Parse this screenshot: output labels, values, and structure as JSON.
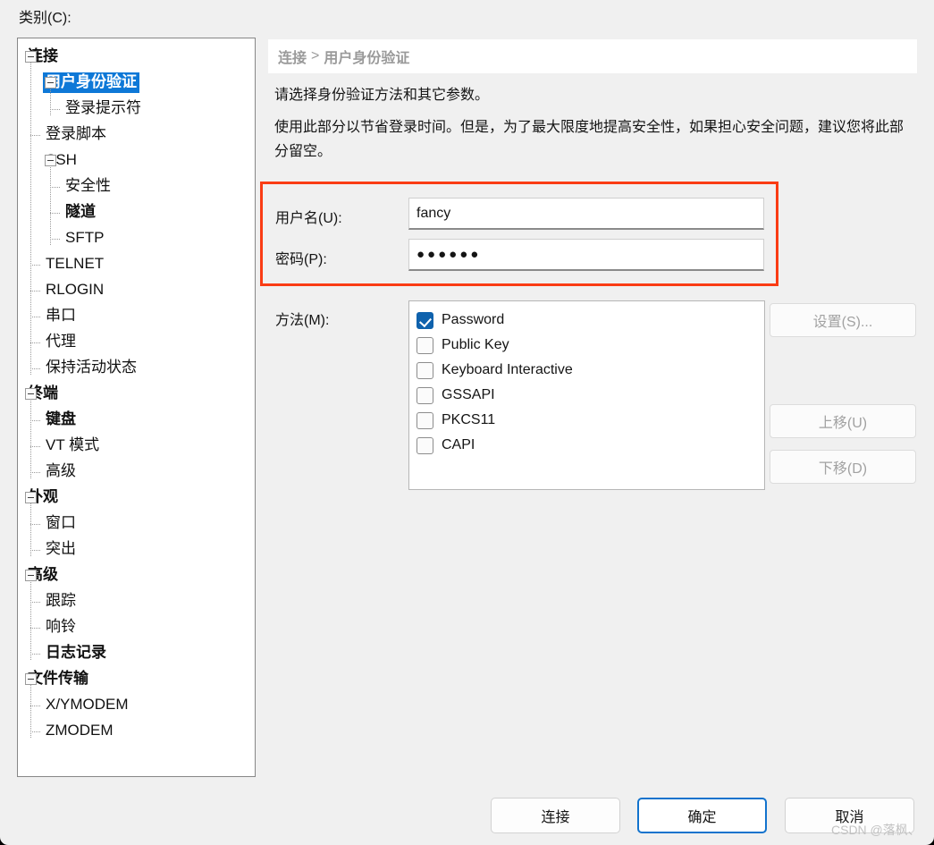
{
  "dialog": {
    "category_label": "类别(C):",
    "watermark": "CSDN @落枫、"
  },
  "tree": {
    "items": [
      {
        "label": "连接",
        "depth": 0,
        "bold": true,
        "selected": false,
        "expander": true
      },
      {
        "label": "用户身份验证",
        "depth": 1,
        "bold": true,
        "selected": true,
        "expander": true
      },
      {
        "label": "登录提示符",
        "depth": 2,
        "bold": false,
        "selected": false,
        "expander": false
      },
      {
        "label": "登录脚本",
        "depth": 1,
        "bold": false,
        "selected": false,
        "expander": false
      },
      {
        "label": "SSH",
        "depth": 1,
        "bold": false,
        "selected": false,
        "expander": true
      },
      {
        "label": "安全性",
        "depth": 2,
        "bold": false,
        "selected": false,
        "expander": false
      },
      {
        "label": "隧道",
        "depth": 2,
        "bold": true,
        "selected": false,
        "expander": false
      },
      {
        "label": "SFTP",
        "depth": 2,
        "bold": false,
        "selected": false,
        "expander": false
      },
      {
        "label": "TELNET",
        "depth": 1,
        "bold": false,
        "selected": false,
        "expander": false
      },
      {
        "label": "RLOGIN",
        "depth": 1,
        "bold": false,
        "selected": false,
        "expander": false
      },
      {
        "label": "串口",
        "depth": 1,
        "bold": false,
        "selected": false,
        "expander": false
      },
      {
        "label": "代理",
        "depth": 1,
        "bold": false,
        "selected": false,
        "expander": false
      },
      {
        "label": "保持活动状态",
        "depth": 1,
        "bold": false,
        "selected": false,
        "expander": false
      },
      {
        "label": "终端",
        "depth": 0,
        "bold": true,
        "selected": false,
        "expander": true
      },
      {
        "label": "键盘",
        "depth": 1,
        "bold": true,
        "selected": false,
        "expander": false
      },
      {
        "label": "VT 模式",
        "depth": 1,
        "bold": false,
        "selected": false,
        "expander": false
      },
      {
        "label": "高级",
        "depth": 1,
        "bold": false,
        "selected": false,
        "expander": false
      },
      {
        "label": "外观",
        "depth": 0,
        "bold": true,
        "selected": false,
        "expander": true
      },
      {
        "label": "窗口",
        "depth": 1,
        "bold": false,
        "selected": false,
        "expander": false
      },
      {
        "label": "突出",
        "depth": 1,
        "bold": false,
        "selected": false,
        "expander": false
      },
      {
        "label": "高级",
        "depth": 0,
        "bold": true,
        "selected": false,
        "expander": true
      },
      {
        "label": "跟踪",
        "depth": 1,
        "bold": false,
        "selected": false,
        "expander": false
      },
      {
        "label": "响铃",
        "depth": 1,
        "bold": false,
        "selected": false,
        "expander": false
      },
      {
        "label": "日志记录",
        "depth": 1,
        "bold": true,
        "selected": false,
        "expander": false
      },
      {
        "label": "文件传输",
        "depth": 0,
        "bold": true,
        "selected": false,
        "expander": true
      },
      {
        "label": "X/YMODEM",
        "depth": 1,
        "bold": false,
        "selected": false,
        "expander": false
      },
      {
        "label": "ZMODEM",
        "depth": 1,
        "bold": false,
        "selected": false,
        "expander": false
      }
    ]
  },
  "pane": {
    "breadcrumb": {
      "parent": "连接",
      "separator": ">",
      "current": "用户身份验证"
    },
    "description_1": "请选择身份验证方法和其它参数。",
    "description_2": "使用此部分以节省登录时间。但是，为了最大限度地提高安全性，如果担心安全问题，建议您将此部分留空。",
    "username": {
      "label": "用户名(U):",
      "value": "fancy",
      "placeholder": ""
    },
    "password": {
      "label": "密码(P):",
      "value": "●●●●●●",
      "placeholder": ""
    },
    "methods": {
      "label": "方法(M):",
      "items": [
        {
          "label": "Password",
          "checked": true
        },
        {
          "label": "Public Key",
          "checked": false
        },
        {
          "label": "Keyboard Interactive",
          "checked": false
        },
        {
          "label": "GSSAPI",
          "checked": false
        },
        {
          "label": "PKCS11",
          "checked": false
        },
        {
          "label": "CAPI",
          "checked": false
        }
      ]
    },
    "side_buttons": {
      "settings": "设置(S)...",
      "move_up": "上移(U)",
      "move_down": "下移(D)"
    }
  },
  "footer": {
    "connect": "连接",
    "ok": "确定",
    "cancel": "取消"
  },
  "colors": {
    "accent_blue": "#0e78d7",
    "highlight_red": "#fa3c14",
    "checkbox_blue": "#0f62ad",
    "dialog_bg": "#f0f0f0"
  }
}
